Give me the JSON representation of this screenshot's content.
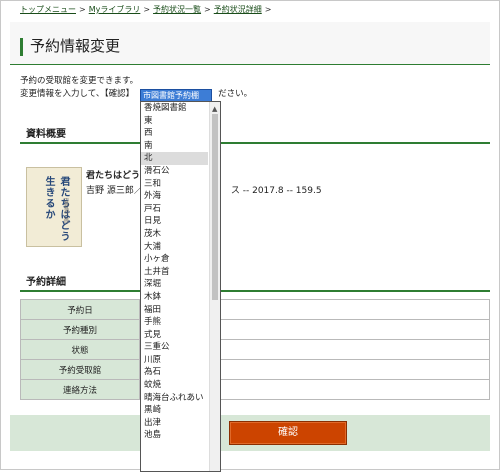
{
  "breadcrumb": {
    "items": [
      "トップメニュー",
      "Myライブラリ",
      "予約状況一覧",
      "予約状況詳細"
    ],
    "sep": ">"
  },
  "page_title": "予約情報変更",
  "intro": {
    "line1": "予約の受取館を変更できます。",
    "line2_before": "変更情報を入力して、【確認】",
    "line2_after": "ださい。"
  },
  "select": {
    "selected": "市図書館予約棚"
  },
  "pickup_options": [
    "香焼図書館",
    "東",
    "西",
    "南",
    "北",
    "滑石公",
    "三和",
    "外海",
    "戸石",
    "日見",
    "茂木",
    "大浦",
    "小ヶ倉",
    "土井首",
    "深堀",
    "木鉢",
    "福田",
    "手熊",
    "式見",
    "三重公",
    "川原",
    "為石",
    "蚊焼",
    "晴海台ふれあい",
    "黒崎",
    "出津",
    "池島"
  ],
  "highlighted_option": "北",
  "sections": {
    "summary": "資料概要",
    "details": "予約詳細"
  },
  "book": {
    "cover_title": "君たちはどう生きるか",
    "cover_author": "吉野源三郎",
    "title": "君たちはどう生",
    "meta_left": "吉野 源三郎／",
    "meta_right": "ス -- 2017.8 -- 159.5"
  },
  "details_rows": [
    {
      "label": "予約日"
    },
    {
      "label": "予約種別"
    },
    {
      "label": "状態"
    },
    {
      "label": "予約受取館"
    },
    {
      "label": "連絡方法"
    }
  ],
  "buttons": {
    "confirm": "確認"
  }
}
